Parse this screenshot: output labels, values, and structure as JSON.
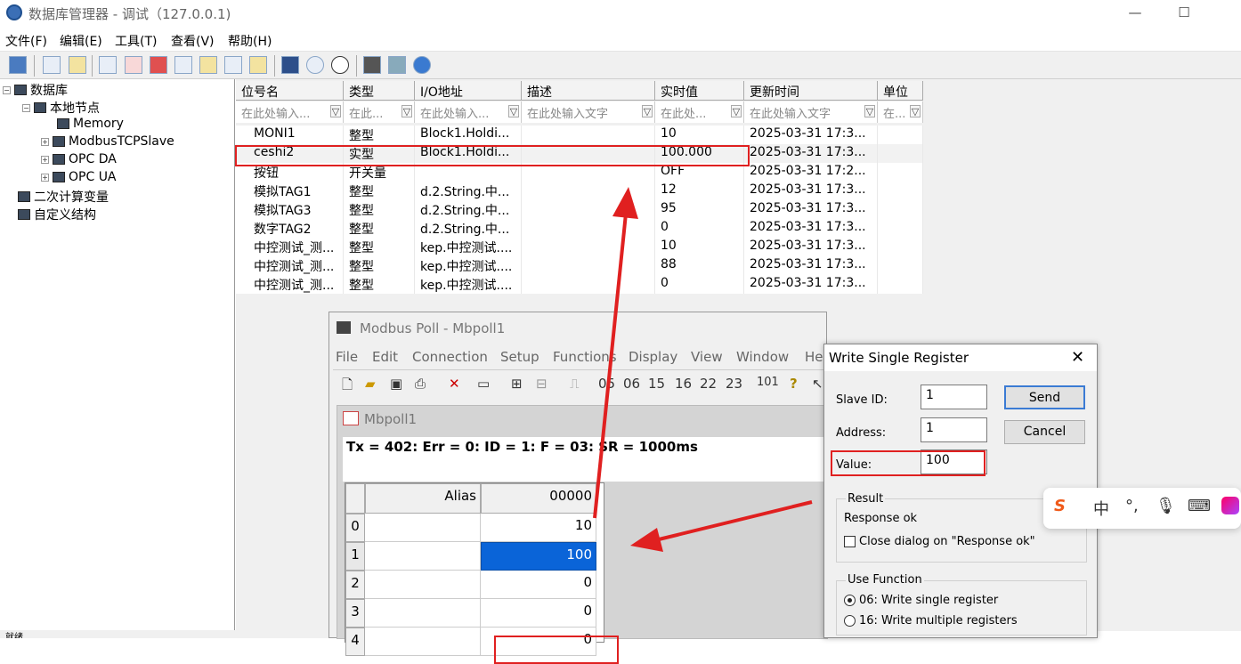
{
  "window": {
    "title": "数据库管理器 - 调试（127.0.0.1)",
    "min": "—",
    "max": "☐"
  },
  "menu": [
    "文件(F)",
    "编辑(E)",
    "工具(T)",
    "查看(V)",
    "帮助(H)"
  ],
  "tree": {
    "root": "数据库",
    "local": "本地节点",
    "children": [
      "Memory",
      "ModbusTCPSlave",
      "OPC DA",
      "OPC UA"
    ],
    "calc": "二次计算变量",
    "custom": "自定义结构"
  },
  "columns": [
    "位号名",
    "类型",
    "I/O地址",
    "描述",
    "实时值",
    "更新时间",
    "单位"
  ],
  "filters": [
    "在此处输入...",
    "在此...",
    "在此处输入...",
    "在此处输入文字",
    "在此处...",
    "在此处输入文字",
    "在..."
  ],
  "rows": [
    [
      "MONI1",
      "整型",
      "Block1.Holdi...",
      "",
      "10",
      "2025-03-31 17:3..."
    ],
    [
      "ceshi2",
      "实型",
      "Block1.Holdi...",
      "",
      "100.000",
      "2025-03-31 17:3..."
    ],
    [
      "按钮",
      "开关量",
      "",
      "",
      "OFF",
      "2025-03-31 17:2..."
    ],
    [
      "模拟TAG1",
      "整型",
      "d.2.String.中...",
      "",
      "12",
      "2025-03-31 17:3..."
    ],
    [
      "模拟TAG3",
      "整型",
      "d.2.String.中...",
      "",
      "95",
      "2025-03-31 17:3..."
    ],
    [
      "数字TAG2",
      "整型",
      "d.2.String.中...",
      "",
      "0",
      "2025-03-31 17:3..."
    ],
    [
      "中控测试_测...",
      "整型",
      "kep.中控测试....",
      "",
      "10",
      "2025-03-31 17:3..."
    ],
    [
      "中控测试_测...",
      "整型",
      "kep.中控测试....",
      "",
      "88",
      "2025-03-31 17:3..."
    ],
    [
      "中控测试_测...",
      "整型",
      "kep.中控测试....",
      "",
      "0",
      "2025-03-31 17:3..."
    ]
  ],
  "modbus": {
    "title": "Modbus Poll - Mbpoll1",
    "menu": [
      "File",
      "Edit",
      "Connection",
      "Setup",
      "Functions",
      "Display",
      "View",
      "Window",
      "He"
    ],
    "tool": [
      "05",
      "06",
      "15",
      "16",
      "22",
      "23",
      "101",
      "?"
    ],
    "child_title": "Mbpoll1",
    "tx": "Tx = 402: Err = 0: ID = 1: F = 03: SR = 1000ms",
    "alias": "Alias",
    "addr": "00000",
    "row_nums": [
      "0",
      "1",
      "2",
      "3",
      "4"
    ],
    "values": [
      "10",
      "100",
      "0",
      "0",
      "0"
    ]
  },
  "dialog": {
    "title": "Write Single Register",
    "slave_label": "Slave ID:",
    "slave": "1",
    "address_label": "Address:",
    "address": "1",
    "value_label": "Value:",
    "value": "100",
    "send": "Send",
    "cancel": "Cancel",
    "result_label": "Result",
    "result": "Response ok",
    "close_opt": "Close dialog on \"Response ok\"",
    "use_fn": "Use Function",
    "fn06": "06: Write single register",
    "fn16": "16: Write multiple registers"
  },
  "ime": {
    "logo": "S",
    "lang": "中",
    "punct": "°,",
    "mic": "🎙",
    "kbd": "⌨"
  },
  "status": "就绪"
}
